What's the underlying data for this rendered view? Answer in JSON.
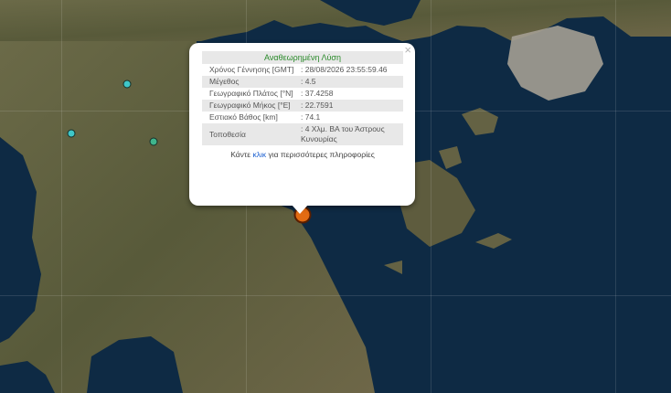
{
  "map": {
    "colors": {
      "sea": "#0e2a44",
      "land_dark": "#4a4a30",
      "land_mid": "#6b6a48",
      "land_light": "#8a8460",
      "urban": "#a49f94"
    },
    "small_marker_color": "#3fc6c8",
    "small_marker_color_alt": "#3fb58c",
    "main_marker_color": "#e36b12"
  },
  "popup": {
    "close_glyph": "×",
    "title": "Αναθεωρημένη Λύση",
    "rows": [
      {
        "label": "Χρόνος Γέννησης [GMT]",
        "value": ": 28/08/2026 23:55:59.46"
      },
      {
        "label": "Μέγεθος",
        "value": ": 4.5"
      },
      {
        "label": "Γεωγραφικό Πλάτος [°N]",
        "value": ": 37.4258"
      },
      {
        "label": "Γεωγραφικό Μήκος [°E]",
        "value": ": 22.7591"
      },
      {
        "label": "Εστιακό Βάθος [km]",
        "value": ": 74.1"
      },
      {
        "label": "Τοποθεσία",
        "value": ": 4 Χλμ. ΒΑ του Άστρους Κυνουρίας"
      }
    ],
    "footer_before": "Κάντε ",
    "footer_link": "κλικ",
    "footer_after": " για περισσότερες πληροφορίες"
  }
}
